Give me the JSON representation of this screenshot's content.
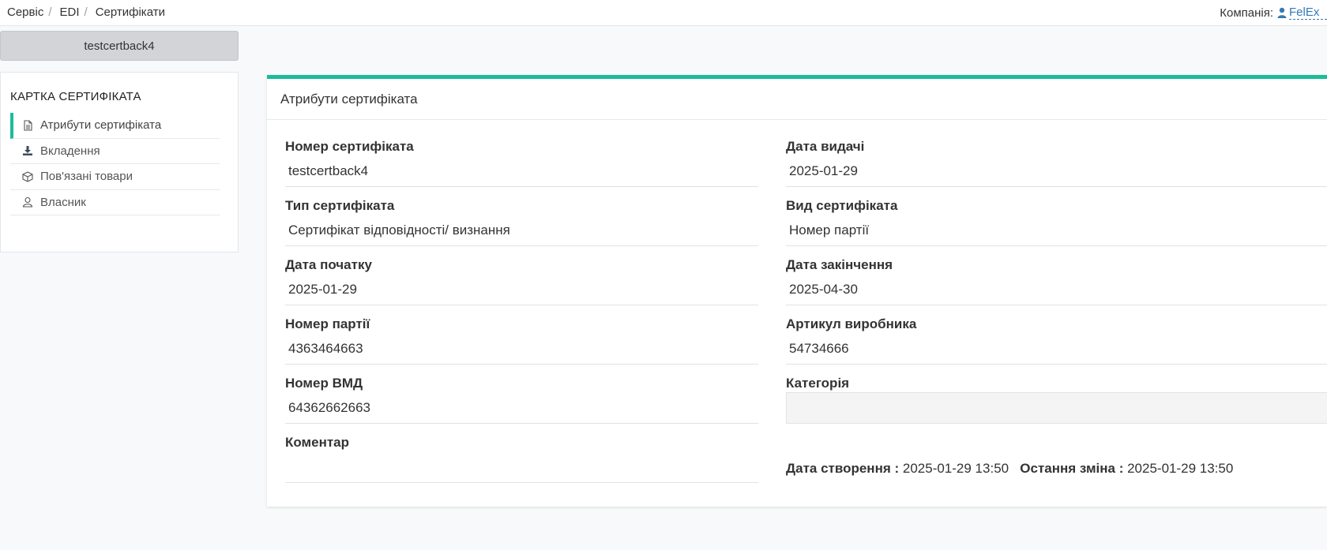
{
  "breadcrumb": [
    "Сервіс",
    "EDI",
    "Сертифікати"
  ],
  "company": {
    "label": "Компанія:",
    "name": "FelEx"
  },
  "cert_name": "testcertback4",
  "nav": {
    "title": "КАРТКА СЕРТИФІКАТА",
    "items": [
      {
        "label": "Атрибути сертифіката",
        "icon": "document-icon",
        "active": true
      },
      {
        "label": "Вкладення",
        "icon": "download-icon",
        "active": false
      },
      {
        "label": "Пов'язані товари",
        "icon": "box-icon",
        "active": false
      },
      {
        "label": "Власник",
        "icon": "user-icon",
        "active": false
      }
    ]
  },
  "panel": {
    "title": "Атрибути сертифіката",
    "fields": {
      "cert_number": {
        "label": "Номер сертифіката",
        "value": "testcertback4"
      },
      "issue_date": {
        "label": "Дата видачі",
        "value": "2025-01-29"
      },
      "cert_type": {
        "label": "Тип сертифіката",
        "value": "Сертифікат відповідності/ визнання"
      },
      "cert_kind": {
        "label": "Вид сертифіката",
        "value": "Номер партії"
      },
      "start_date": {
        "label": "Дата початку",
        "value": "2025-01-29"
      },
      "end_date": {
        "label": "Дата закінчення",
        "value": "2025-04-30"
      },
      "batch_number": {
        "label": "Номер партії",
        "value": "4363464663"
      },
      "manufacturer_sku": {
        "label": "Артикул виробника",
        "value": "54734666"
      },
      "customs_number": {
        "label": "Номер ВМД",
        "value": "64362662663"
      },
      "category": {
        "label": "Категорія",
        "value": ""
      },
      "comment": {
        "label": "Коментар",
        "value": ""
      }
    },
    "meta": {
      "created_label": "Дата створення :",
      "created_value": "2025-01-29 13:50",
      "modified_label": "Остання зміна :",
      "modified_value": "2025-01-29 13:50"
    }
  },
  "colors": {
    "accent": "#1abc9c",
    "link": "#337ab7"
  }
}
